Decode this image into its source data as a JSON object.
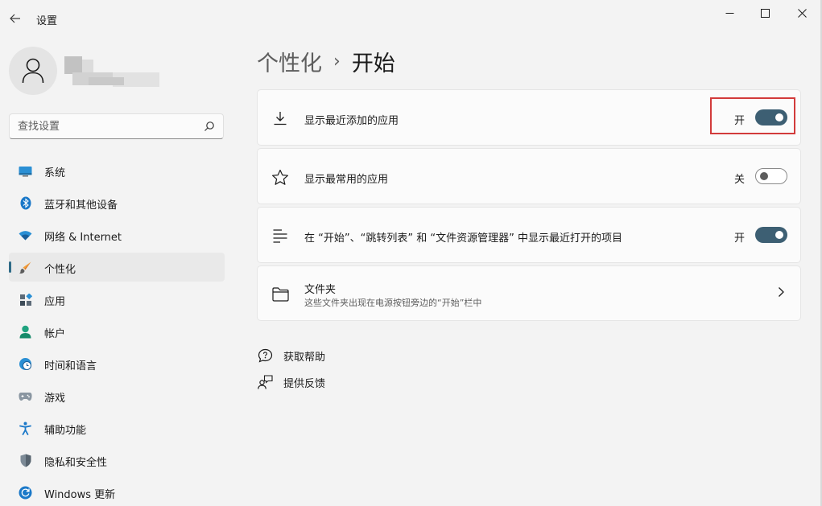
{
  "window": {
    "title": "设置"
  },
  "search": {
    "placeholder": "查找设置"
  },
  "sidebar": {
    "items": [
      {
        "label": "系统",
        "icon": "monitor-icon"
      },
      {
        "label": "蓝牙和其他设备",
        "icon": "bluetooth-icon"
      },
      {
        "label": "网络 & Internet",
        "icon": "wifi-icon"
      },
      {
        "label": "个性化",
        "icon": "brush-icon",
        "active": true
      },
      {
        "label": "应用",
        "icon": "apps-icon"
      },
      {
        "label": "帐户",
        "icon": "account-icon"
      },
      {
        "label": "时间和语言",
        "icon": "globe-clock-icon"
      },
      {
        "label": "游戏",
        "icon": "gamepad-icon"
      },
      {
        "label": "辅助功能",
        "icon": "accessibility-icon"
      },
      {
        "label": "隐私和安全性",
        "icon": "shield-icon"
      },
      {
        "label": "Windows 更新",
        "icon": "update-icon"
      }
    ]
  },
  "breadcrumb": {
    "parent": "个性化",
    "separator": "›",
    "current": "开始"
  },
  "settings": [
    {
      "label": "显示最近添加的应用",
      "state": "开",
      "on": true,
      "icon": "download-icon"
    },
    {
      "label": "显示最常用的应用",
      "state": "关",
      "on": false,
      "icon": "star-icon"
    },
    {
      "label": "在 “开始”、“跳转列表” 和 “文件资源管理器” 中显示最近打开的项目",
      "state": "开",
      "on": true,
      "icon": "list-icon"
    },
    {
      "label": "文件夹",
      "sublabel": "这些文件夹出现在电源按钮旁边的“开始”栏中",
      "icon": "folder-icon"
    }
  ],
  "links": {
    "help": "获取帮助",
    "feedback": "提供反馈"
  },
  "colors": {
    "accent": "#3d5f73",
    "highlight": "#d23b3b",
    "background": "#f3f3f3",
    "card": "#fbfbfb"
  }
}
